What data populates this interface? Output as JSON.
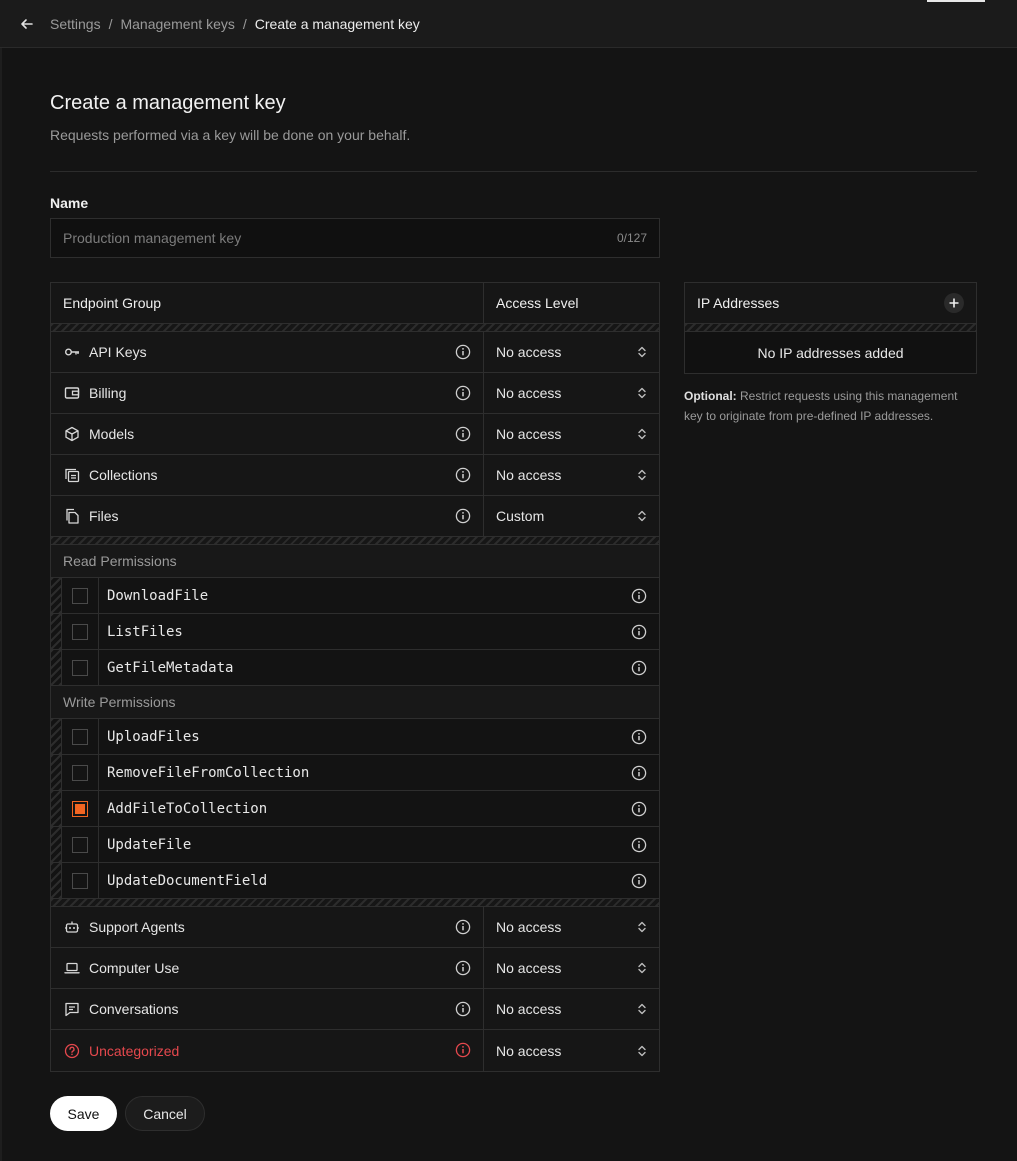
{
  "breadcrumb": [
    "Settings",
    "Management keys",
    "Create a management key"
  ],
  "page": {
    "title": "Create a management key",
    "subtitle": "Requests performed via a key will be done on your behalf."
  },
  "name_field": {
    "label": "Name",
    "placeholder": "Production management key",
    "value": "",
    "counter": "0/127"
  },
  "table": {
    "col_group": "Endpoint Group",
    "col_access": "Access Level",
    "groups_top": [
      {
        "label": "API Keys",
        "icon": "key-icon",
        "access": "No access"
      },
      {
        "label": "Billing",
        "icon": "wallet-icon",
        "access": "No access"
      },
      {
        "label": "Models",
        "icon": "cube-icon",
        "access": "No access"
      },
      {
        "label": "Collections",
        "icon": "collections-icon",
        "access": "No access"
      },
      {
        "label": "Files",
        "icon": "files-icon",
        "access": "Custom"
      }
    ],
    "read_title": "Read Permissions",
    "read_permissions": [
      {
        "name": "DownloadFile",
        "checked": false
      },
      {
        "name": "ListFiles",
        "checked": false
      },
      {
        "name": "GetFileMetadata",
        "checked": false
      }
    ],
    "write_title": "Write Permissions",
    "write_permissions": [
      {
        "name": "UploadFiles",
        "checked": false
      },
      {
        "name": "RemoveFileFromCollection",
        "checked": false
      },
      {
        "name": "AddFileToCollection",
        "checked": true
      },
      {
        "name": "UpdateFile",
        "checked": false
      },
      {
        "name": "UpdateDocumentField",
        "checked": false
      }
    ],
    "groups_bottom": [
      {
        "label": "Support Agents",
        "icon": "robot-icon",
        "access": "No access"
      },
      {
        "label": "Computer Use",
        "icon": "laptop-icon",
        "access": "No access"
      },
      {
        "label": "Conversations",
        "icon": "chat-icon",
        "access": "No access"
      },
      {
        "label": "Uncategorized",
        "icon": "question-icon",
        "access": "No access",
        "alert": true
      }
    ]
  },
  "ip": {
    "title": "IP Addresses",
    "empty": "No IP addresses added",
    "note_bold": "Optional:",
    "note": "Restrict requests using this management key to originate from pre-defined IP addresses."
  },
  "actions": {
    "save": "Save",
    "cancel": "Cancel"
  },
  "colors": {
    "accent": "#f26522",
    "danger": "#e5484d",
    "background": "#141414"
  }
}
